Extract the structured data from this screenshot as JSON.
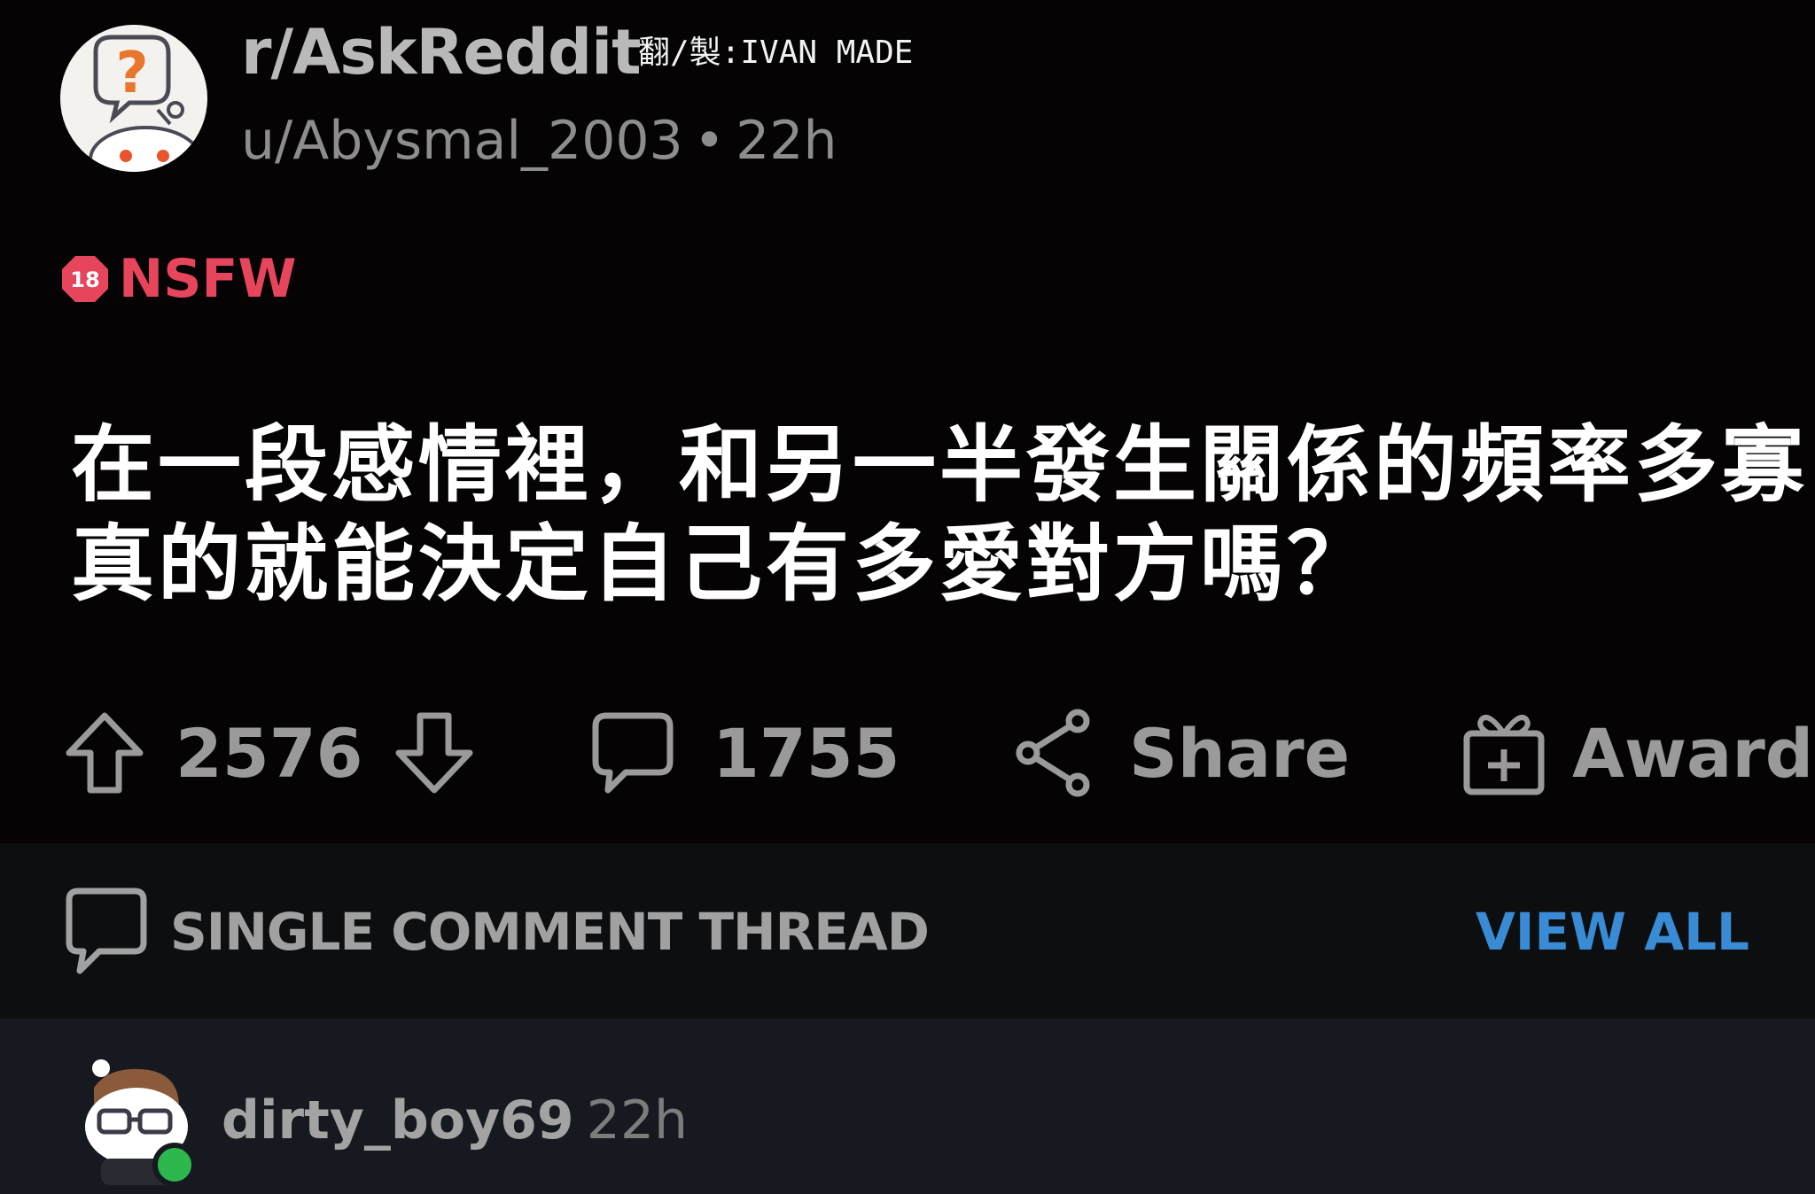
{
  "header": {
    "subreddit": "r/AskReddit",
    "author": "u/Abysmal_2003",
    "separator": "•",
    "age": "22h",
    "watermark": "翻/製:IVAN MADE"
  },
  "nsfw": {
    "badge_number": "18",
    "label": "NSFW"
  },
  "post": {
    "title_lines": [
      "在一段感情裡，和另一半發生關係的頻率多寡",
      "真的就能決定自己有多愛對方嗎？"
    ]
  },
  "actions": {
    "upvote_count": "2576",
    "comment_count": "1755",
    "share_label": "Share",
    "award_label": "Award"
  },
  "thread": {
    "label": "SINGLE COMMENT THREAD",
    "view_all_label": "VIEW ALL"
  },
  "comment": {
    "username": "dirty_boy69",
    "age": "22h"
  },
  "colors": {
    "background": "#050304",
    "nsfw": "#e6455c",
    "link": "#3a8bd6",
    "online": "#2db84d"
  },
  "icons": {
    "upvote": "arrow-up-icon",
    "downvote": "arrow-down-icon",
    "comments": "speech-bubble-icon",
    "share": "share-nodes-icon",
    "award": "gift-plus-icon"
  }
}
